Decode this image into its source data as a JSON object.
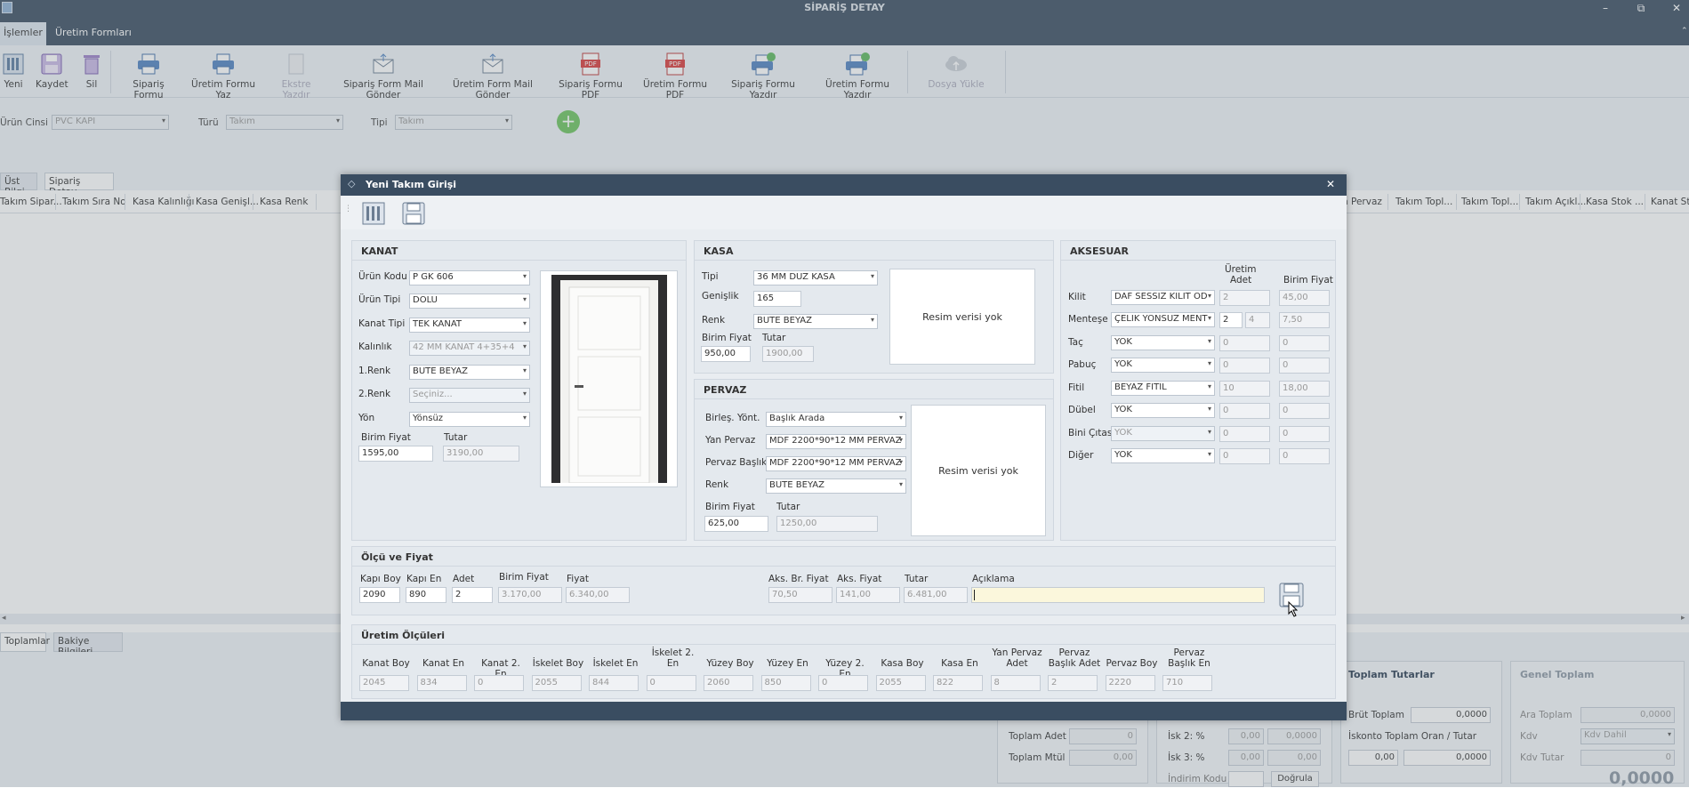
{
  "app": {
    "title": "SİPARİŞ DETAY",
    "win_min": "–",
    "win_restore": "⧉",
    "win_close": "✕"
  },
  "menu": {
    "tabs": [
      {
        "label": "İşlemler"
      },
      {
        "label": "Üretim Formları"
      }
    ]
  },
  "toolbar": {
    "items": [
      {
        "label": "Yeni",
        "icon": "new-doc-icon"
      },
      {
        "label": "Kaydet",
        "icon": "save-icon"
      },
      {
        "label": "Sil",
        "icon": "trash-icon"
      },
      {
        "label": "Sipariş Formu",
        "icon": "print-icon"
      },
      {
        "label": "Üretim Formu Yaz",
        "icon": "print-icon"
      },
      {
        "label": "Ekstre Yazdır",
        "icon": "document-icon"
      },
      {
        "label": "Sipariş Form Mail Gönder",
        "icon": "mail-send-icon"
      },
      {
        "label": "Üretim Form Mail Gönder",
        "icon": "mail-send-icon"
      },
      {
        "label": "Sipariş Formu PDF",
        "icon": "pdf-icon"
      },
      {
        "label": "Üretim Formu PDF",
        "icon": "pdf-icon"
      },
      {
        "label": "Sipariş Formu Yazdır",
        "icon": "print-check-icon"
      },
      {
        "label": "Üretim Formu Yazdır",
        "icon": "print-check-icon"
      },
      {
        "label": "Dosya Yükle",
        "icon": "cloud-upload-icon"
      }
    ]
  },
  "filters": {
    "urun_cinsi_label": "Ürün Cinsi",
    "urun_cinsi_value": "PVC KAPI",
    "turu_label": "Türü",
    "turu_value": "Takım",
    "tipi_label": "Tipi",
    "tipi_value": "Takım",
    "add_symbol": "+"
  },
  "page_tabs": [
    {
      "label": "Üst Bilgi"
    },
    {
      "label": "Sipariş Detay"
    }
  ],
  "grid": {
    "headers_left": [
      "Takım Sipar...",
      "Takım Sıra No",
      "Kasa Kalınlığı",
      "Kasa Genişl...",
      "Kasa Renk"
    ],
    "headers_right": [
      "n Pervaz",
      "Takım Topl...",
      "Takım Topl...",
      "Takım Açıkl...",
      "Kasa Stok ...",
      "Kanat Sto"
    ]
  },
  "bottom_tabs": [
    {
      "label": "Toplamlar"
    },
    {
      "label": "Bakiye Bilgileri"
    }
  ],
  "totals": {
    "toplam_adet_label": "Toplam Adet",
    "toplam_adet": "0",
    "toplam_mtul_label": "Toplam Mtül",
    "toplam_mtul": "0,00",
    "isk2_label": "İsk 2: %",
    "isk2_a": "0,00",
    "isk2_b": "0,0000",
    "isk3_label": "İsk 3: %",
    "isk3_a": "0,00",
    "isk3_b": "0,00",
    "indirim_kodu_label": "İndirim Kodu",
    "indirim_kodu": "",
    "dogrula_label": "Doğrula",
    "toplam_tutarlar_title": "Toplam Tutarlar",
    "brut_toplam_label": "Brüt Toplam",
    "brut_toplam": "0,0000",
    "iskonto_label": "İskonto Toplam Oran / Tutar",
    "iskonto_oran": "0,00",
    "iskonto_tutar": "0,0000",
    "genel_toplam_title": "Genel Toplam",
    "ara_toplam_label": "Ara Toplam",
    "ara_toplam": "0,0000",
    "kdv_label": "Kdv",
    "kdv_value": "Kdv Dahil",
    "kdv_tutar_label": "Kdv Tutar",
    "kdv_tutar": "0",
    "genel_toplam": "0,0000"
  },
  "modal": {
    "title": "Yeni Takım Girişi",
    "close": "✕",
    "kanat": {
      "title": "KANAT",
      "urun_kodu_label": "Ürün Kodu",
      "urun_kodu": "P GK 606",
      "urun_tipi_label": "Ürün Tipi",
      "urun_tipi": "DOLU",
      "kanat_tipi_label": "Kanat Tipi",
      "kanat_tipi": "TEK KANAT",
      "kalinlik_label": "Kalınlık",
      "kalinlik": "42 MM KANAT 4+35+4",
      "renk1_label": "1.Renk",
      "renk1": "BUTE BEYAZ",
      "renk2_label": "2.Renk",
      "renk2": "Seçiniz...",
      "yon_label": "Yön",
      "yon": "Yönsüz",
      "birim_fiyat_label": "Birim Fiyat",
      "birim_fiyat": "1595,00",
      "tutar_label": "Tutar",
      "tutar": "3190,00"
    },
    "kasa": {
      "title": "KASA",
      "tipi_label": "Tipi",
      "tipi": "36 MM DÜZ KASA",
      "genislik_label": "Genişlik",
      "genislik": "165",
      "renk_label": "Renk",
      "renk": "BUTE BEYAZ",
      "birim_fiyat_label": "Birim Fiyat",
      "birim_fiyat": "950,00",
      "tutar_label": "Tutar",
      "tutar": "1900,00",
      "image_text": "Resim verisi yok"
    },
    "pervaz": {
      "title": "PERVAZ",
      "birles_label": "Birleş. Yönt.",
      "birles": "Başlık Arada",
      "yan_label": "Yan Pervaz",
      "yan": "MDF 2200*90*12 MM PERVAZ",
      "baslik_label": "Pervaz Başlık",
      "baslik": "MDF 2200*90*12 MM PERVAZ",
      "renk_label": "Renk",
      "renk": "BUTE BEYAZ",
      "birim_fiyat_label": "Birim Fiyat",
      "birim_fiyat": "625,00",
      "tutar_label": "Tutar",
      "tutar": "1250,00",
      "image_text": "Resim verisi yok"
    },
    "aksesuar": {
      "title": "AKSESUAR",
      "col_uretim": "Üretim",
      "col_adet": "Adet",
      "col_birim": "Birim Fiyat",
      "rows": [
        {
          "label": "Kilit",
          "value": "DAF SESSİZ KİLİT OD",
          "adet": "",
          "uretim": "2",
          "fiyat": "45,00",
          "enabled": true
        },
        {
          "label": "Menteşe",
          "value": "ÇELİK YÖNSÜZ MENT",
          "adet": "2",
          "uretim": "4",
          "fiyat": "7,50",
          "enabled": true
        },
        {
          "label": "Taç",
          "value": "YOK",
          "adet": "",
          "uretim": "0",
          "fiyat": "0",
          "enabled": true
        },
        {
          "label": "Pabuç",
          "value": "YOK",
          "adet": "",
          "uretim": "0",
          "fiyat": "0",
          "enabled": true
        },
        {
          "label": "Fitil",
          "value": "BEYAZ FİTİL",
          "adet": "",
          "uretim": "10",
          "fiyat": "18,00",
          "enabled": true
        },
        {
          "label": "Dübel",
          "value": "YOK",
          "adet": "",
          "uretim": "0",
          "fiyat": "0",
          "enabled": true
        },
        {
          "label": "Bini Çıtası",
          "value": "YOK",
          "adet": "",
          "uretim": "0",
          "fiyat": "0",
          "enabled": false
        },
        {
          "label": "Diğer",
          "value": "YOK",
          "adet": "",
          "uretim": "0",
          "fiyat": "0",
          "enabled": true
        }
      ]
    },
    "olcu": {
      "title": "Ölçü ve Fiyat",
      "kapi_boy_label": "Kapı Boy",
      "kapi_boy": "2090",
      "kapi_en_label": "Kapı En",
      "kapi_en": "890",
      "adet_label": "Adet",
      "adet": "2",
      "birim_fiyat_label": "Birim Fiyat",
      "birim_fiyat": "3.170,00",
      "fiyat_label": "Fiyat",
      "fiyat": "6.340,00",
      "aks_br_label": "Aks. Br. Fiyat",
      "aks_br": "70,50",
      "aks_fiyat_label": "Aks. Fiyat",
      "aks_fiyat": "141,00",
      "tutar_label": "Tutar",
      "tutar": "6.481,00",
      "aciklama_label": "Açıklama",
      "aciklama": ""
    },
    "uretim": {
      "title": "Üretim Ölçüleri",
      "items": [
        {
          "label": "Kanat Boy",
          "value": "2045"
        },
        {
          "label": "Kanat En",
          "value": "834"
        },
        {
          "label": "Kanat 2. En",
          "value": "0"
        },
        {
          "label": "İskelet Boy",
          "value": "2055"
        },
        {
          "label": "İskelet En",
          "value": "844"
        },
        {
          "label": "İskelet 2. En",
          "value": "0"
        },
        {
          "label": "Yüzey Boy",
          "value": "2060"
        },
        {
          "label": "Yüzey En",
          "value": "850"
        },
        {
          "label": "Yüzey 2. En",
          "value": "0"
        },
        {
          "label": "Kasa Boy",
          "value": "2055"
        },
        {
          "label": "Kasa En",
          "value": "822"
        },
        {
          "label": "Yan Pervaz Adet",
          "value": "8"
        },
        {
          "label": "Pervaz Başlık Adet",
          "value": "2"
        },
        {
          "label": "Pervaz Boy",
          "value": "2220"
        },
        {
          "label": "Pervaz Başlık En",
          "value": "710"
        }
      ]
    }
  }
}
